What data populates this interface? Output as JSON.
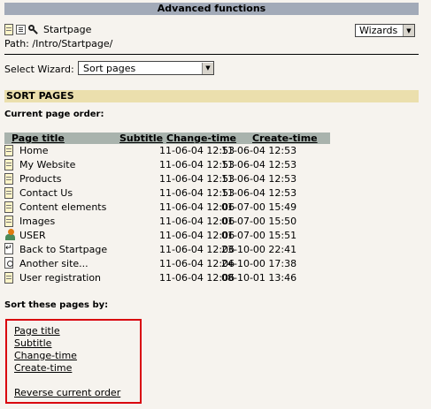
{
  "header": {
    "title": "Advanced functions"
  },
  "toolbar": {
    "startpage_label": "Startpage"
  },
  "path_text": "Path: /Intro/Startpage/",
  "wizards_select": {
    "value": "Wizards"
  },
  "wizard": {
    "label": "Select Wizard:",
    "value": "Sort pages"
  },
  "section": {
    "title": "SORT PAGES"
  },
  "current_order_label": "Current page order:",
  "table": {
    "headers": [
      "Page title",
      "Subtitle",
      "Change-time",
      "Create-time"
    ],
    "rows": [
      {
        "title": "Home",
        "icon": "page-icon",
        "change": "11-06-04 12:53",
        "create": "11-06-04 12:53"
      },
      {
        "title": "My Website",
        "icon": "page-icon",
        "change": "11-06-04 12:53",
        "create": "11-06-04 12:53"
      },
      {
        "title": "Products",
        "icon": "page-icon",
        "change": "11-06-04 12:53",
        "create": "11-06-04 12:53"
      },
      {
        "title": "Contact Us",
        "icon": "page-icon",
        "change": "11-06-04 12:53",
        "create": "11-06-04 12:53"
      },
      {
        "title": "Content elements",
        "icon": "page-icon",
        "change": "11-06-04 12:06",
        "create": "01-07-00 15:49"
      },
      {
        "title": "Images",
        "icon": "page-icon",
        "change": "11-06-04 12:06",
        "create": "01-07-00 15:50"
      },
      {
        "title": "USER",
        "icon": "user-folder-icon",
        "change": "11-06-04 12:06",
        "create": "01-07-00 15:51"
      },
      {
        "title": "Back to Startpage",
        "icon": "shortcut-icon",
        "change": "11-06-04 12:06",
        "create": "23-10-00 22:41"
      },
      {
        "title": "Another site...",
        "icon": "external-link-icon",
        "change": "11-06-04 12:06",
        "create": "24-10-00 17:38"
      },
      {
        "title": "User registration",
        "icon": "page-icon",
        "change": "11-06-04 12:06",
        "create": "08-10-01 13:46"
      }
    ]
  },
  "sort_by_label": "Sort these pages by:",
  "sort_links": {
    "page_title": "Page title",
    "subtitle": "Subtitle",
    "change_time": "Change-time",
    "create_time": "Create-time",
    "reverse": "Reverse current order"
  },
  "colors": {
    "top_bar": "#a2aab8",
    "section_header": "#ebdfad",
    "table_header": "#a9b3ad",
    "highlight_box": "#d9000d",
    "background": "#f6f3ee"
  }
}
